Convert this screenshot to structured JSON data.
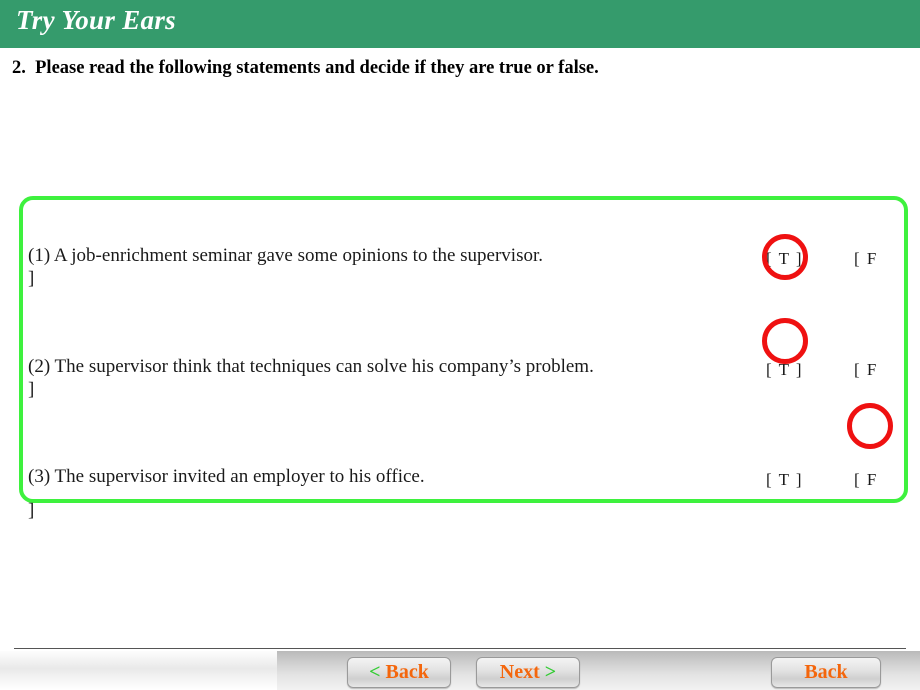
{
  "header": {
    "title": "Try Your Ears",
    "background_color": "#359b6c",
    "text_color": "#ffffff"
  },
  "instruction": {
    "text": "2.  Please read the following statements and decide if they are true or false."
  },
  "answer_box": {
    "border_color": "#3ef13e"
  },
  "statements": [
    {
      "number": "(1)",
      "text": "(1) A job-enrichment seminar gave some opinions to the supervisor.",
      "true_option": "[ T ]",
      "false_option": "[ F",
      "wrapped_bracket": "]",
      "circled_option": "true"
    },
    {
      "number": "(2)",
      "text": "(2) The supervisor think that techniques can solve his company’s problem.",
      "true_option": "[ T ]",
      "false_option": "[ F",
      "wrapped_bracket": "]",
      "circled_option": "true"
    },
    {
      "number": "(3)",
      "text": "(3) The supervisor invited an employer to his office.",
      "true_option": "[ T ]",
      "false_option": "[ F",
      "wrapped_bracket": "]",
      "circled_option": "false"
    }
  ],
  "annotations": {
    "circle_color": "#ef1111"
  },
  "footer": {
    "buttons": [
      {
        "arrow_lead": "<",
        "label": "Back",
        "arrow_trail": ""
      },
      {
        "arrow_lead": "",
        "label": "Next",
        "arrow_trail": ">"
      },
      {
        "arrow_lead": "",
        "label": "Back",
        "arrow_trail": ""
      }
    ],
    "arrow_color": "#33cc33",
    "label_color": "#f4660c"
  }
}
